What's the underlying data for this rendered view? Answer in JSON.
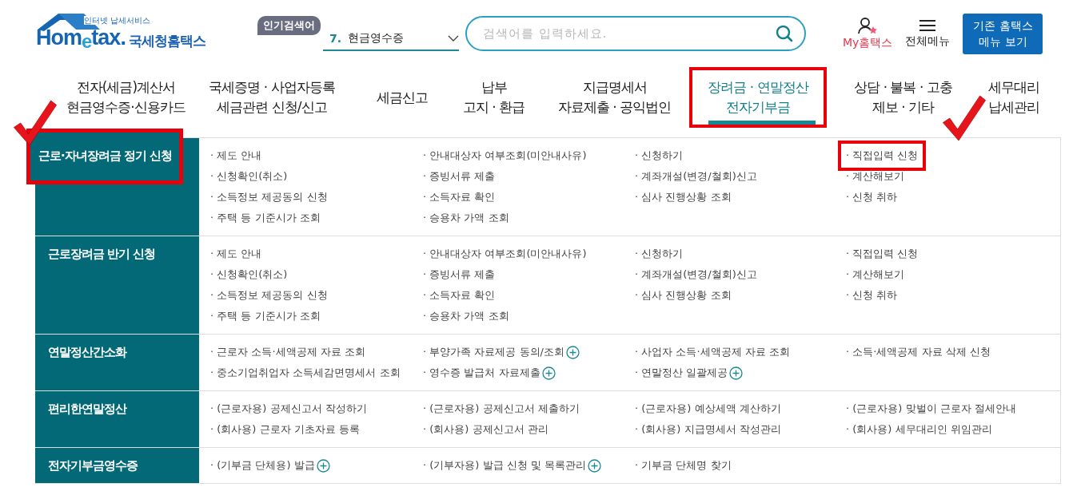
{
  "logo": {
    "tagline": "인터넷 납세서비스",
    "wordmark": "Hom$_{e}$tax.",
    "name": "국세청홈택스"
  },
  "popular": {
    "badge": "인기검색어",
    "rank": "7.",
    "term": "현금영수증"
  },
  "search": {
    "placeholder": "검색어를 입력하세요."
  },
  "utilities": [
    {
      "kind": "my",
      "label": "My홈택스"
    },
    {
      "kind": "menu",
      "label": "전체메뉴"
    }
  ],
  "legacy_button": {
    "lines": [
      "기존 홈택스",
      "메뉴 보기"
    ]
  },
  "nav": [
    {
      "lines": [
        "전자(세금)계산서",
        "현금영수증·신용카드"
      ],
      "selected": false,
      "framed": false
    },
    {
      "lines": [
        "국세증명 · 사업자등록",
        "세금관련 신청/신고"
      ],
      "selected": false,
      "framed": false
    },
    {
      "lines": [
        "세금신고"
      ],
      "selected": false,
      "framed": false
    },
    {
      "lines": [
        "납부",
        "고지 · 환급"
      ],
      "selected": false,
      "framed": false
    },
    {
      "lines": [
        "지급명세서",
        "자료제출 · 공익법인"
      ],
      "selected": false,
      "framed": false
    },
    {
      "lines": [
        "장려금 · 연말정산",
        "전자기부금"
      ],
      "selected": true,
      "framed": true
    },
    {
      "lines": [
        "상담 · 불복 · 고충",
        "제보 · 기타"
      ],
      "selected": false,
      "framed": false
    },
    {
      "lines": [
        "세무대리",
        "납세관리"
      ],
      "selected": false,
      "framed": false
    }
  ],
  "sections": [
    {
      "title": "근로·자녀장려금 정기 신청",
      "framed": true,
      "checkmark": true,
      "columns": [
        [
          {
            "text": "· 제도 안내"
          },
          {
            "text": "· 신청확인(취소)"
          },
          {
            "text": "· 소득정보 제공동의 신청"
          },
          {
            "text": "· 주택 등 기준시가 조회"
          }
        ],
        [
          {
            "text": "· 안내대상자 여부조회(미안내사유)"
          },
          {
            "text": "· 증빙서류 제출"
          },
          {
            "text": "· 소득자료 확인"
          },
          {
            "text": "· 승용차 가액 조회"
          }
        ],
        [
          {
            "text": "· 신청하기"
          },
          {
            "text": "· 계좌개설(변경/철회)신고"
          },
          {
            "text": "· 심사 진행상황 조회"
          }
        ],
        [
          {
            "text": "· 직접입력 신청",
            "framed": true,
            "checkmark": true
          },
          {
            "text": "· 계산해보기"
          },
          {
            "text": "· 신청 취하"
          }
        ]
      ]
    },
    {
      "title": "근로장려금 반기 신청",
      "framed": false,
      "checkmark": false,
      "columns": [
        [
          {
            "text": "· 제도 안내"
          },
          {
            "text": "· 신청확인(취소)"
          },
          {
            "text": "· 소득정보 제공동의 신청"
          },
          {
            "text": "· 주택 등 기준시가 조회"
          }
        ],
        [
          {
            "text": "· 안내대상자 여부조회(미안내사유)"
          },
          {
            "text": "· 증빙서류 제출"
          },
          {
            "text": "· 소득자료 확인"
          },
          {
            "text": "· 승용차 가액 조회"
          }
        ],
        [
          {
            "text": "· 신청하기"
          },
          {
            "text": "· 계좌개설(변경/철회)신고"
          },
          {
            "text": "· 심사 진행상황 조회"
          }
        ],
        [
          {
            "text": "· 직접입력 신청"
          },
          {
            "text": "· 계산해보기"
          },
          {
            "text": "· 신청 취하"
          }
        ]
      ]
    },
    {
      "title": "연말정산간소화",
      "framed": false,
      "checkmark": false,
      "columns": [
        [
          {
            "text": "· 근로자 소득·세액공제 자료 조회",
            "plus": false
          },
          {
            "text": "· 중소기업취업자 소득세감면명세서 조회",
            "plus": false
          }
        ],
        [
          {
            "text": "· 부양가족 자료제공 동의/조회",
            "plus": true
          },
          {
            "text": "· 영수증 발급처 자료제출",
            "plus": true
          }
        ],
        [
          {
            "text": "· 사업자 소득·세액공제 자료 조회",
            "plus": false
          },
          {
            "text": "· 연말정산 일괄제공",
            "plus": true
          }
        ],
        [
          {
            "text": "· 소득·세액공제 자료 삭제 신청",
            "plus": false
          }
        ]
      ]
    },
    {
      "title": "편리한연말정산",
      "framed": false,
      "checkmark": false,
      "columns": [
        [
          {
            "text": "· (근로자용) 공제신고서 작성하기"
          },
          {
            "text": "· (회사용) 근로자 기초자료 등록"
          }
        ],
        [
          {
            "text": "· (근로자용) 공제신고서 제출하기"
          },
          {
            "text": "· (회사용) 공제신고서 관리"
          }
        ],
        [
          {
            "text": "· (근로자용) 예상세액 계산하기"
          },
          {
            "text": "· (회사용) 지급명세서 작성관리"
          }
        ],
        [
          {
            "text": "· (근로자용) 맞벌이 근로자 절세안내"
          },
          {
            "text": "· (회사용) 세무대리인 위임관리"
          }
        ]
      ]
    },
    {
      "title": "전자기부금영수증",
      "framed": false,
      "checkmark": false,
      "columns": [
        [
          {
            "text": "· (기부금 단체용) 발급",
            "plus": true
          }
        ],
        [
          {
            "text": "· (기부자용) 발급 신청 및 목록관리",
            "plus": true
          }
        ],
        [
          {
            "text": "· 기부금 단체명 찾기",
            "plus": false
          }
        ]
      ]
    }
  ]
}
